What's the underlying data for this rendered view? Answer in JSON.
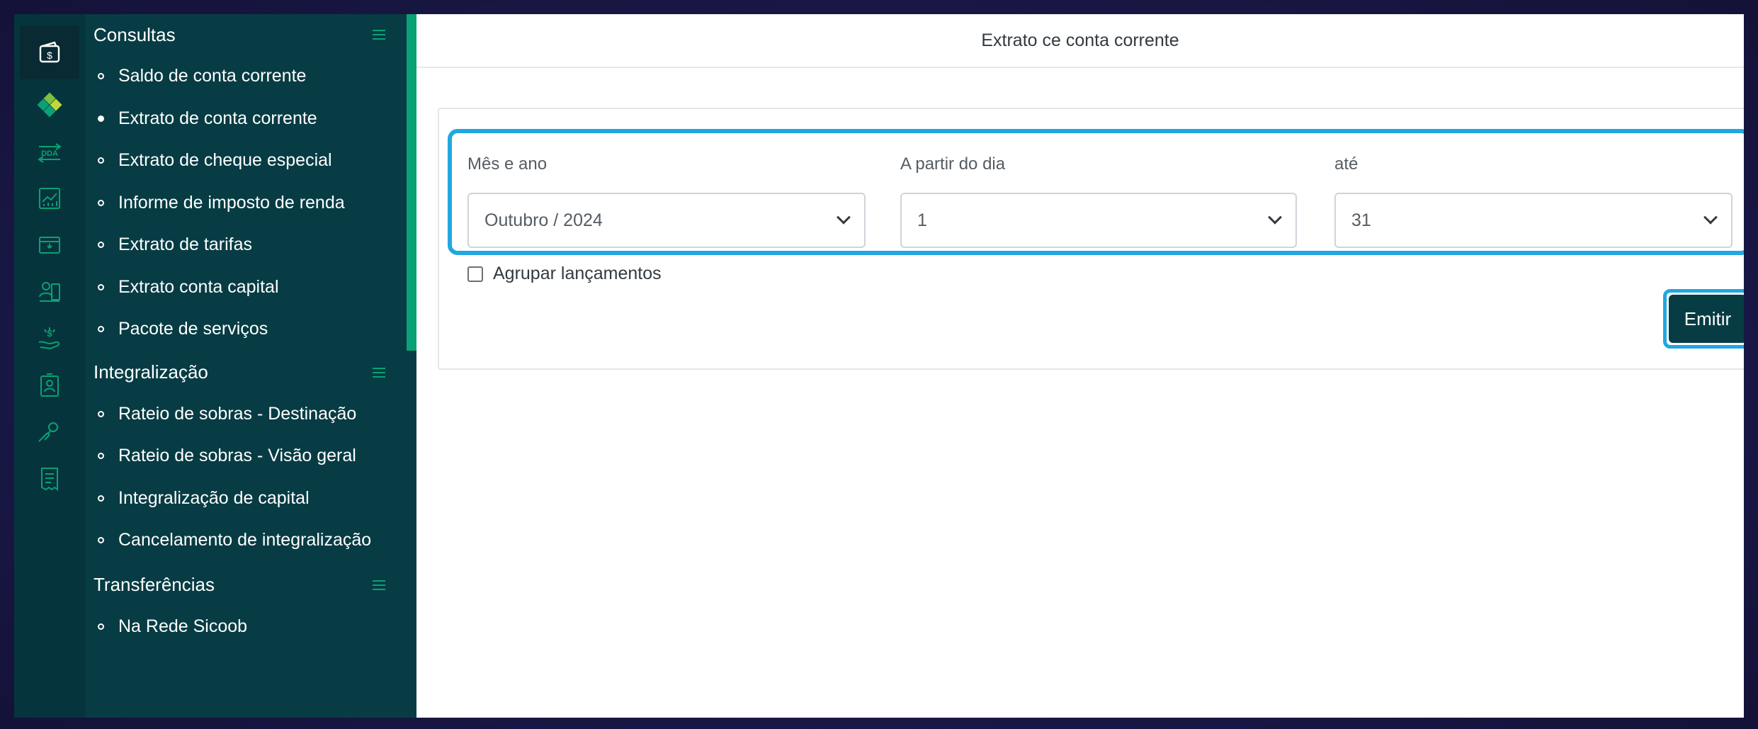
{
  "header": {
    "title": "Extrato ce conta corrente"
  },
  "rail": {
    "icons": [
      "wallet-icon",
      "diamond-logo-icon",
      "dda-icon",
      "chart-icon",
      "card-icon",
      "person-document-icon",
      "money-hand-icon",
      "id-badge-icon",
      "handshake-icon",
      "receipt-icon"
    ],
    "dda_label": "DDA"
  },
  "menu": {
    "sections": [
      {
        "title": "Consultas",
        "items": [
          "Saldo de conta corrente",
          "Extrato de conta corrente",
          "Extrato de cheque especial",
          "Informe de imposto de renda",
          "Extrato de tarifas",
          "Extrato conta capital",
          "Pacote de serviços"
        ],
        "active_index": 1
      },
      {
        "title": "Integralização",
        "items": [
          "Rateio de sobras - Destinação",
          "Rateio de sobras - Visão geral",
          "Integralização de capital",
          "Cancelamento de integralização"
        ]
      },
      {
        "title": "Transferências",
        "items": [
          "Na Rede Sicoob"
        ]
      }
    ]
  },
  "form": {
    "month_year": {
      "label": "Mês e ano",
      "value": "Outubro / 2024"
    },
    "from_day": {
      "label": "A partir do dia",
      "value": "1"
    },
    "to_day": {
      "label": "até",
      "value": "31"
    },
    "group_checkbox": {
      "label": "Agrupar lançamentos",
      "checked": false
    },
    "submit_label": "Emitir",
    "info_icon": "i"
  },
  "colors": {
    "sidebar_dark": "#073c44",
    "rail": "#06343c",
    "accent_green": "#0aa174",
    "highlight_blue": "#21a7e0"
  }
}
